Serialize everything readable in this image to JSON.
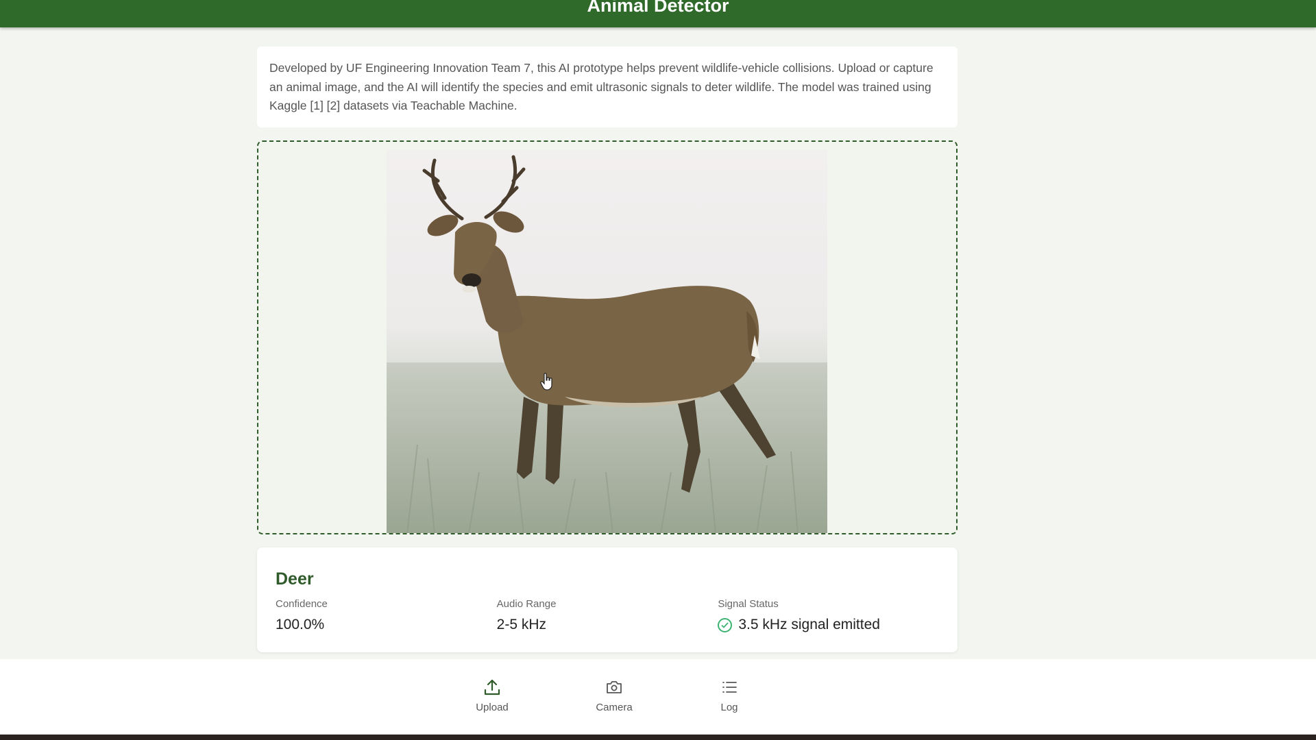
{
  "header": {
    "title": "Animal Detector"
  },
  "description": {
    "text": "Developed by UF Engineering Innovation Team 7, this AI prototype helps prevent wildlife-vehicle collisions. Upload or capture an animal image, and the AI will identify the species and emit ultrasonic signals to deter wildlife. The model was trained using Kaggle [1] [2] datasets via Teachable Machine."
  },
  "preview": {
    "image_subject": "deer-photo"
  },
  "result": {
    "animal": "Deer",
    "confidence_label": "Confidence",
    "confidence_value": "100.0%",
    "audio_label": "Audio Range",
    "audio_value": "2-5 kHz",
    "signal_label": "Signal Status",
    "signal_value": "3.5 kHz signal emitted"
  },
  "nav": {
    "upload": "Upload",
    "camera": "Camera",
    "log": "Log"
  },
  "colors": {
    "primary": "#2f6a2a",
    "accent_text": "#2f5a2a",
    "success": "#3cb371"
  }
}
